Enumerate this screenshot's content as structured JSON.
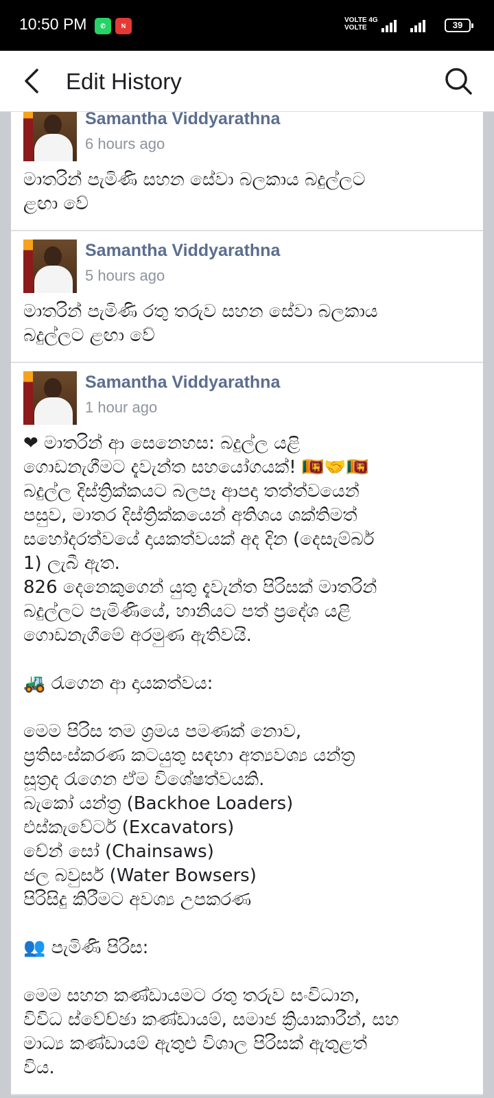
{
  "status_bar": {
    "time": "10:50 PM",
    "network_label_1": "VOLTE",
    "network_label_2": "VOLTE",
    "network_type": "4G",
    "battery": "39",
    "icons": [
      "whatsapp-icon",
      "news-app-icon",
      "signal-icon",
      "battery-icon"
    ]
  },
  "header": {
    "title": "Edit History",
    "icons": [
      "back-arrow-icon",
      "search-icon"
    ]
  },
  "entries": [
    {
      "author": "Samantha Viddyarathna",
      "time": "6 hours ago",
      "lines": [
        "මාතරින් පැමිණි සහන සේවා බලකාය බදුල්ලට",
        "ළඟා වේ"
      ]
    },
    {
      "author": "Samantha Viddyarathna",
      "time": "5 hours ago",
      "lines": [
        "මාතරින් පැමිණි රතු තරුව සහන සේවා බලකාය",
        "බදුල්ලට ළඟා වේ"
      ]
    },
    {
      "author": "Samantha Viddyarathna",
      "time": "1 hour ago",
      "lines": [
        "❤ මාතරින් ආ සෙනෙහස: බදුල්ල යළි",
        "ගොඩනැගීමට දැවැන්ත සහයෝගයක්! 🇱🇰🤝🇱🇰",
        "බදුල්ල දිස්ත්‍රික්කයට බලපෑ ආපදා තත්ත්වයෙන්",
        "පසුව, මාතර දිස්ත්‍රික්කයෙන් අතිශය ශක්තිමත්",
        "සහෝදරත්වයේ දායකත්වයක් අද දින (දෙසැම්බර්",
        "1) ලැබී ඇත.",
        "826 දෙනෙකුගෙන් යුතු දැවැන්ත පිරිසක් මාතරින්",
        "බදුල්ලට පැමිණියේ, හානියට පත් ප්‍රදේශ යළි",
        "ගොඩනැගීමේ අරමුණ ඇතිවයි.",
        "",
        "🚜 රැගෙන ආ දායකත්වය:",
        "",
        "මෙම පිරිස තම ශ්‍රමය පමණක් නොව,",
        "ප්‍රතිසංස්කරණ කටයුතු සඳහා අත්‍යවශ්‍ය යන්ත්‍ර",
        "සූත්‍රද රැගෙන ඒම විශේෂත්වයකි.",
        "බැකෝ යන්ත්‍ර (Backhoe Loaders)",
        "එස්කැවේටර් (Excavators)",
        "චේන් සෝ (Chainsaws)",
        "ජල බවුසර් (Water Bowsers)",
        "පිරිසිදු කිරීමට අවශ්‍ය උපකරණ",
        "",
        "👥 පැමිණි පිරිස:",
        "",
        "මෙම සහන කණ්ඩායමට රතු තරුව සංවිධාන,",
        "විවිධ ස්වේච්ඡා කණ්ඩායම්, සමාජ ක්‍රියාකාරීන්, සහ",
        "මාධ්‍ය කණ්ඩායම් ඇතුළු විශාල පිරිසක් ඇතුළත්",
        "විය."
      ]
    }
  ]
}
